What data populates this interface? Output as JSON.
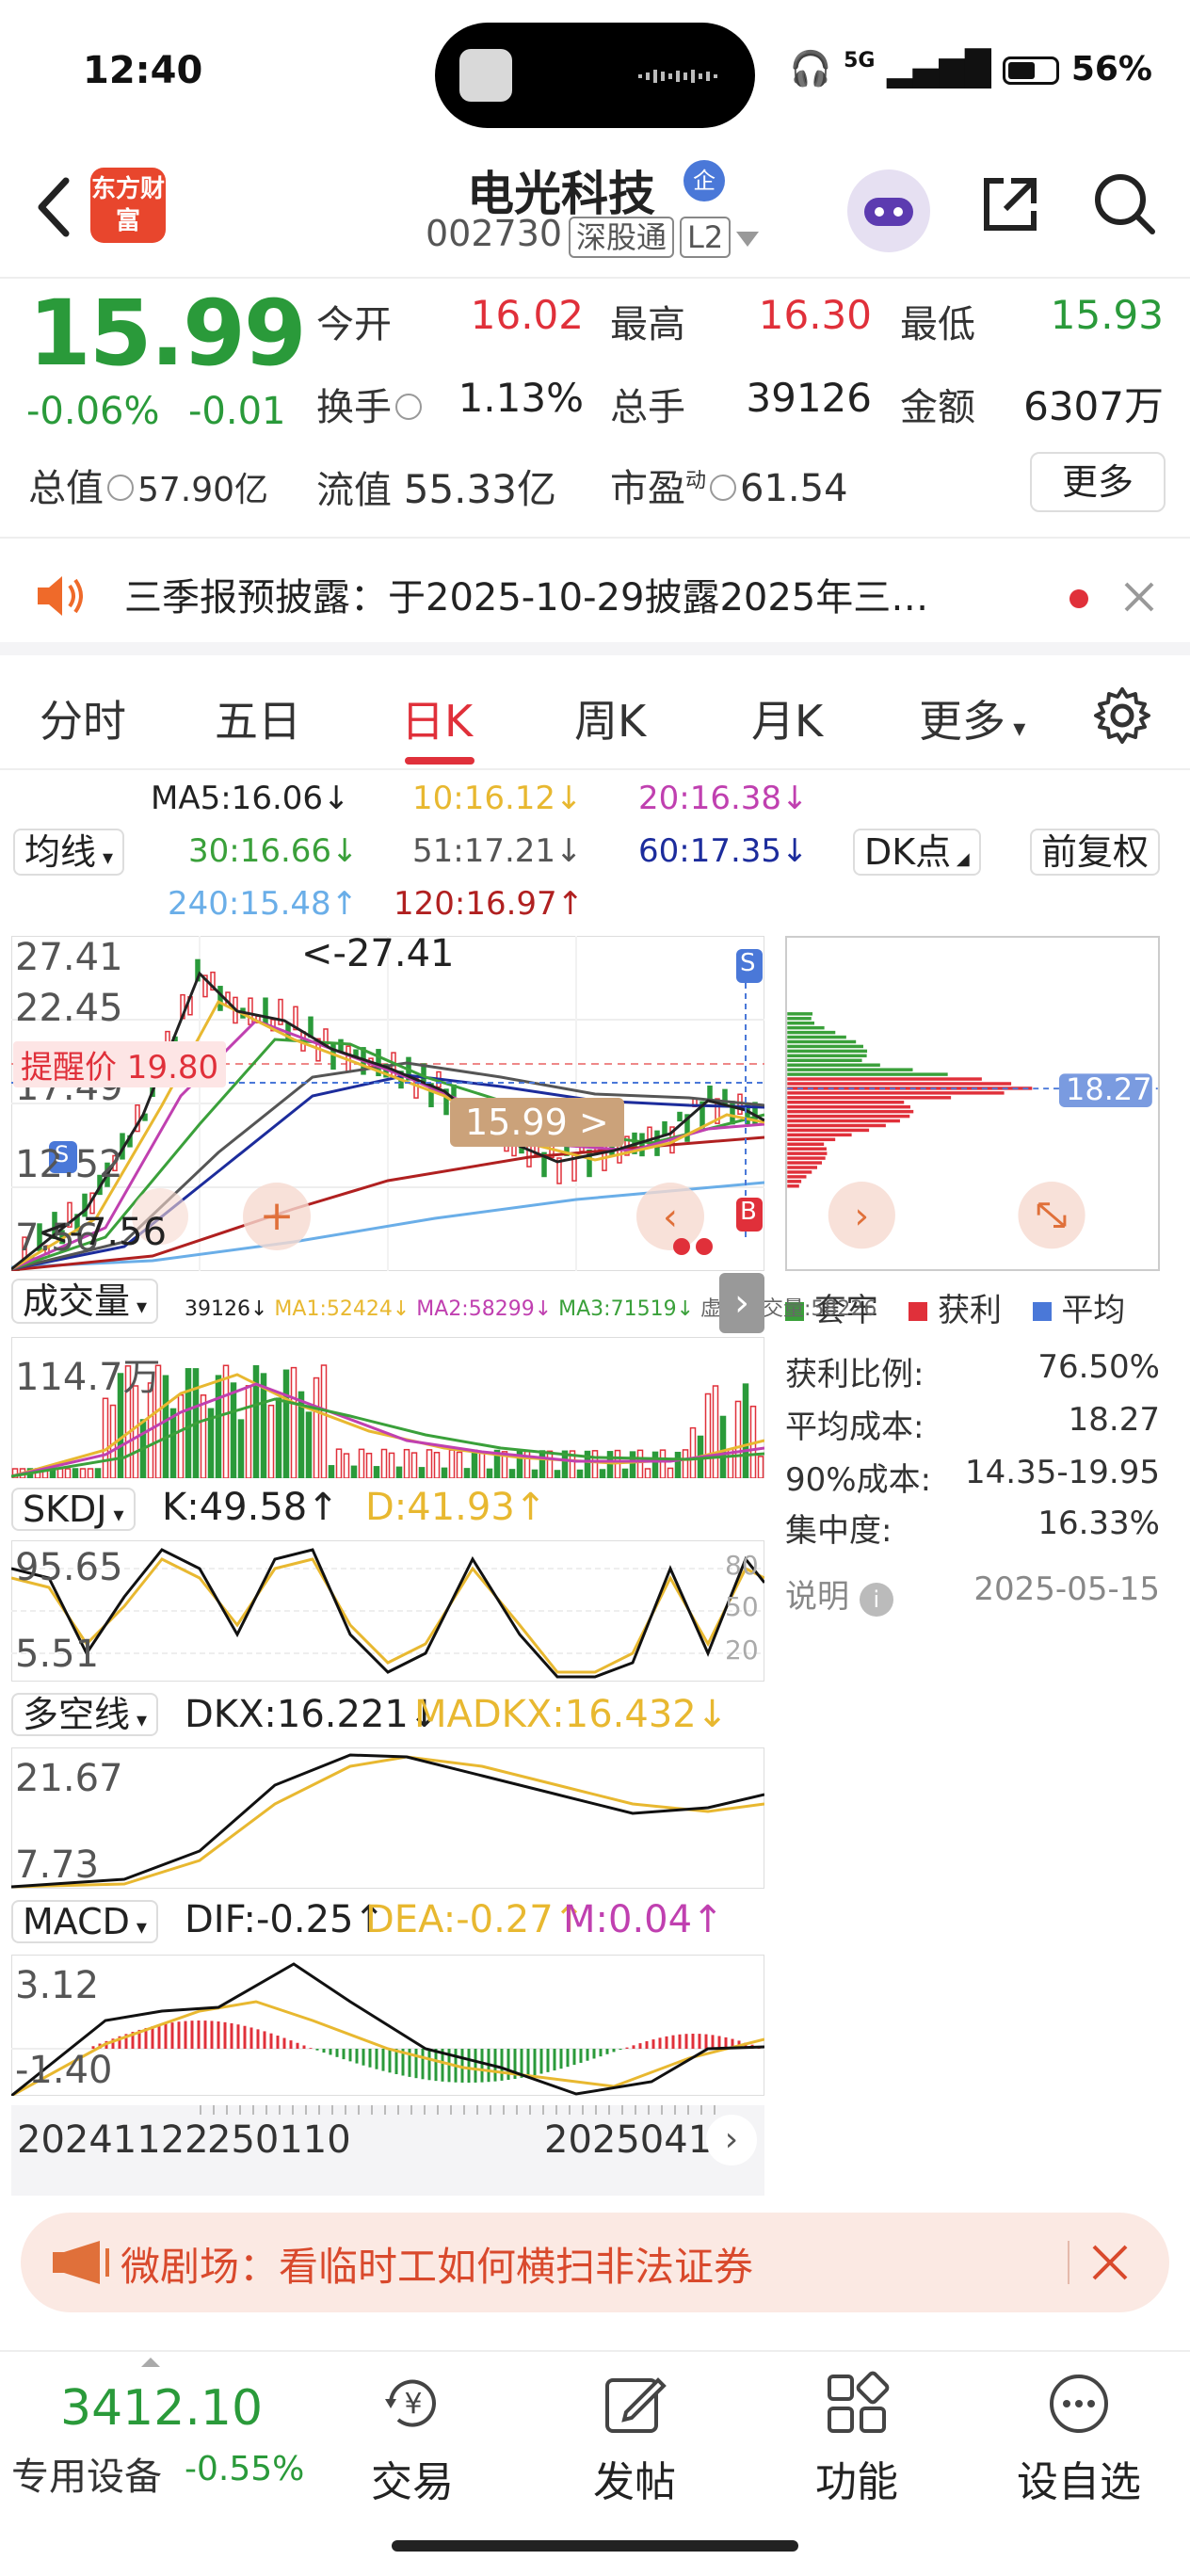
{
  "status_bar": {
    "time": "12:40",
    "network": "5G",
    "battery": "56%"
  },
  "header": {
    "logo_text": "东方财富",
    "stock_name": "电光科技",
    "enterprise_badge": "企",
    "stock_code": "002730",
    "market_tag": "深股通",
    "level_tag": "L2"
  },
  "quote": {
    "price": "15.99",
    "change_pct": "-0.06%",
    "change_abs": "-0.01",
    "open_label": "今开",
    "open": "16.02",
    "high_label": "最高",
    "high": "16.30",
    "low_label": "最低",
    "low": "15.93",
    "turnover_label": "换手",
    "turnover": "1.13%",
    "volume_label": "总手",
    "volume": "39126",
    "amount_label": "金额",
    "amount": "6307万",
    "market_cap_label": "总值",
    "market_cap": "57.90亿",
    "float_cap_label": "流值",
    "float_cap": "55.33亿",
    "pe_label": "市盈",
    "pe_sup": "动",
    "pe": "61.54",
    "more_label": "更多"
  },
  "notice": {
    "text": "三季报预披露：于2025-10-29披露2025年三…"
  },
  "tabs": {
    "items": [
      "分时",
      "五日",
      "日K",
      "周K",
      "月K",
      "更多"
    ],
    "active": "日K"
  },
  "ma_legend": {
    "selector": "均线",
    "ma5": "MA5:16.06↓",
    "ma10": "10:16.12↓",
    "ma20": "20:16.38↓",
    "ma30": "30:16.66↓",
    "ma51": "51:17.21↓",
    "ma60": "60:17.35↓",
    "ma240": "240:15.48↑",
    "ma120": "120:16.97↑",
    "dk_button": "DK点",
    "adjust_button": "前复权"
  },
  "kline": {
    "axis_top": "27.41",
    "axis_2": "22.45",
    "axis_3": "17.49",
    "axis_4": "12.52",
    "axis_5": "7.56",
    "high_marker": "<-27.41",
    "low_marker": "<-7.56",
    "alert_label": "提醒价 19.80",
    "current_tag": "15.99 >",
    "s_marker": "S",
    "b_marker": "B",
    "colors": {
      "ma5": "#222222",
      "ma10": "#e8b830",
      "ma20": "#c040b0",
      "ma30": "#3aa03a",
      "ma51": "#555555",
      "ma60": "#1c2c9c",
      "ma120": "#b02020",
      "ma240": "#6aaee8"
    }
  },
  "volume_panel": {
    "selector": "成交量",
    "legend_vol": "39126↓",
    "legend_ma1": "MA1:52424↓",
    "legend_ma2": "MA2:58299↓",
    "legend_ma3": "MA3:71519↓",
    "legend_virtual": "虚拟成交量:58226",
    "axis_top": "114.7万"
  },
  "skdj_panel": {
    "selector": "SKDJ",
    "k": "K:49.58↑",
    "d": "D:41.93↑",
    "axis_top": "95.65",
    "axis_bottom": "5.51",
    "ref_80": "80",
    "ref_50": "50",
    "ref_20": "20"
  },
  "dkx_panel": {
    "selector": "多空线",
    "dkx": "DKX:16.221↓",
    "madkx": "MADKX:16.432↓",
    "axis_top": "21.67",
    "axis_bottom": "7.73"
  },
  "macd_panel": {
    "selector": "MACD",
    "dif": "DIF:-0.25↑",
    "dea": "DEA:-0.27↑",
    "m": "M:0.04↑",
    "axis_top": "3.12",
    "axis_bottom": "-1.40",
    "date_start": "20241122",
    "date_mid": "250110",
    "date_end": "2025041"
  },
  "chip": {
    "current_cost": "18.27",
    "legend_trapped": "套牢",
    "legend_profit": "获利",
    "legend_avg": "平均",
    "profit_ratio_label": "获利比例:",
    "profit_ratio": "76.50%",
    "avg_cost_label": "平均成本:",
    "avg_cost": "18.27",
    "cost90_label": "90%成本:",
    "cost90": "14.35-19.95",
    "concentration_label": "集中度:",
    "concentration": "16.33%",
    "explain_label": "说明",
    "date": "2025-05-15"
  },
  "banner": {
    "text": "微剧场：看临时工如何横扫非法证券"
  },
  "bottom_bar": {
    "index_value": "3412.10",
    "index_name": "专用设备",
    "index_change": "-0.55%",
    "nav": [
      "交易",
      "发帖",
      "功能",
      "设自选"
    ]
  }
}
